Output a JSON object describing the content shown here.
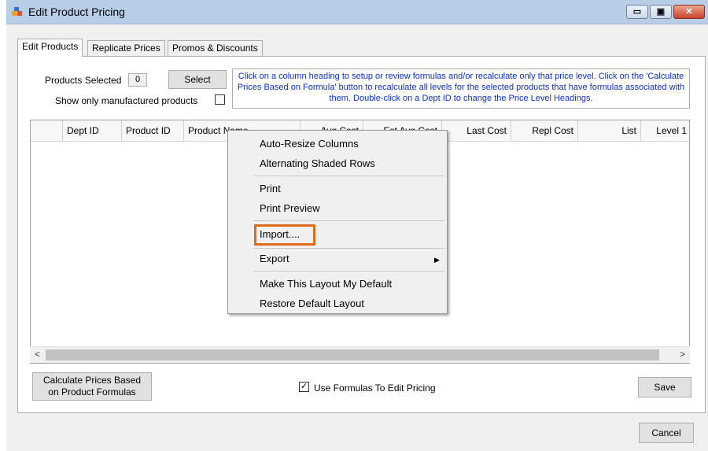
{
  "window": {
    "title": "Edit Product Pricing",
    "minimize_glyph": "▭",
    "maximize_glyph": "▣",
    "close_glyph": "✕"
  },
  "tabs": [
    {
      "label": "Edit Products",
      "active": true
    },
    {
      "label": "Replicate Prices",
      "active": false
    },
    {
      "label": "Promos & Discounts",
      "active": false
    }
  ],
  "selection": {
    "products_selected_label": "Products Selected",
    "products_selected_count": "0",
    "select_button": "Select",
    "show_manufactured_label": "Show only manufactured products",
    "show_manufactured_checked": false
  },
  "info_text": "Click on a column heading to setup or review formulas and/or recalculate only that price level. Click on the 'Calculate Prices Based on Formula' button to recalculate all levels for the selected products that have formulas associated with them. Double-click on a Dept ID to change the Price Level Headings.",
  "grid": {
    "columns": [
      "",
      "Dept ID",
      "Product ID",
      "Product Name",
      "Avg Cost",
      "Est Avg Cost",
      "Last Cost",
      "Repl Cost",
      "List",
      "Level 1"
    ],
    "rows": []
  },
  "context_menu": {
    "items": [
      "Auto-Resize Columns",
      "Alternating Shaded Rows",
      "Print",
      "Print Preview",
      "Import....",
      "Export",
      "Make This Layout My Default",
      "Restore Default Layout"
    ],
    "highlighted": "Import....",
    "highlight_color": "#e06a17"
  },
  "footer": {
    "calc_button_line1": "Calculate Prices Based",
    "calc_button_line2": "on Product Formulas",
    "use_formulas_label": "Use Formulas To Edit Pricing",
    "use_formulas_checked": true,
    "save_button": "Save",
    "cancel_button": "Cancel"
  },
  "colors": {
    "title_bar": "#b8cde6",
    "info_text": "#0a2fd6",
    "close_button": "#c8432c"
  }
}
